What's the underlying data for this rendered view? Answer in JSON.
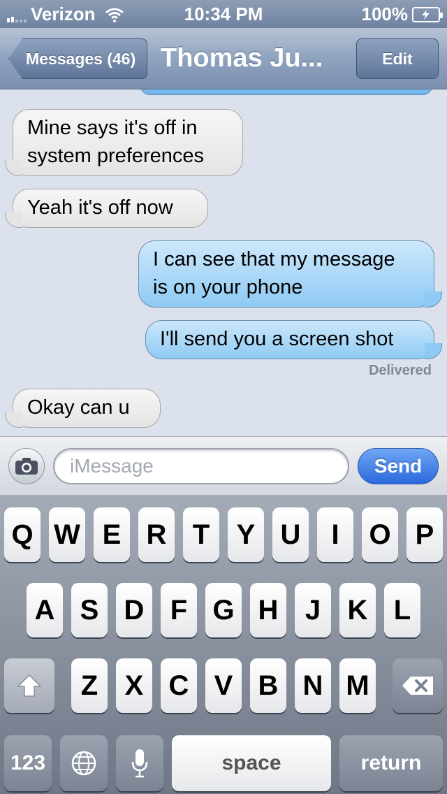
{
  "status_bar": {
    "carrier": "Verizon",
    "time": "10:34 PM",
    "battery": "100%",
    "icons": [
      "signal-icon",
      "wifi-icon",
      "battery-charging-icon"
    ]
  },
  "nav": {
    "back_label": "Messages (46)",
    "title": "Thomas Ju...",
    "edit_label": "Edit"
  },
  "messages": [
    {
      "direction": "incoming",
      "lines": [
        "Mine says it's off in",
        "system preferences"
      ]
    },
    {
      "direction": "incoming",
      "lines": [
        "Yeah it's off now"
      ]
    },
    {
      "direction": "outgoing",
      "lines": [
        "I can see that my message",
        "is on your phone"
      ]
    },
    {
      "direction": "outgoing",
      "lines": [
        "I'll send you a screen shot"
      ]
    },
    {
      "direction": "incoming",
      "lines": [
        "Okay can u"
      ]
    }
  ],
  "delivered_label": "Delivered",
  "input_bar": {
    "placeholder": "iMessage",
    "value": "",
    "send_label": "Send"
  },
  "keyboard": {
    "row1": [
      "Q",
      "W",
      "E",
      "R",
      "T",
      "Y",
      "U",
      "I",
      "O",
      "P"
    ],
    "row2": [
      "A",
      "S",
      "D",
      "F",
      "G",
      "H",
      "J",
      "K",
      "L"
    ],
    "row3": [
      "Z",
      "X",
      "C",
      "V",
      "B",
      "N",
      "M"
    ],
    "numbers_label": "123",
    "space_label": "space",
    "return_label": "return"
  },
  "colors": {
    "accent_blue": "#2b68dd",
    "outgoing_bubble": "#8ecaf4",
    "incoming_bubble": "#e4e4e4",
    "background": "#dbe2ed"
  }
}
